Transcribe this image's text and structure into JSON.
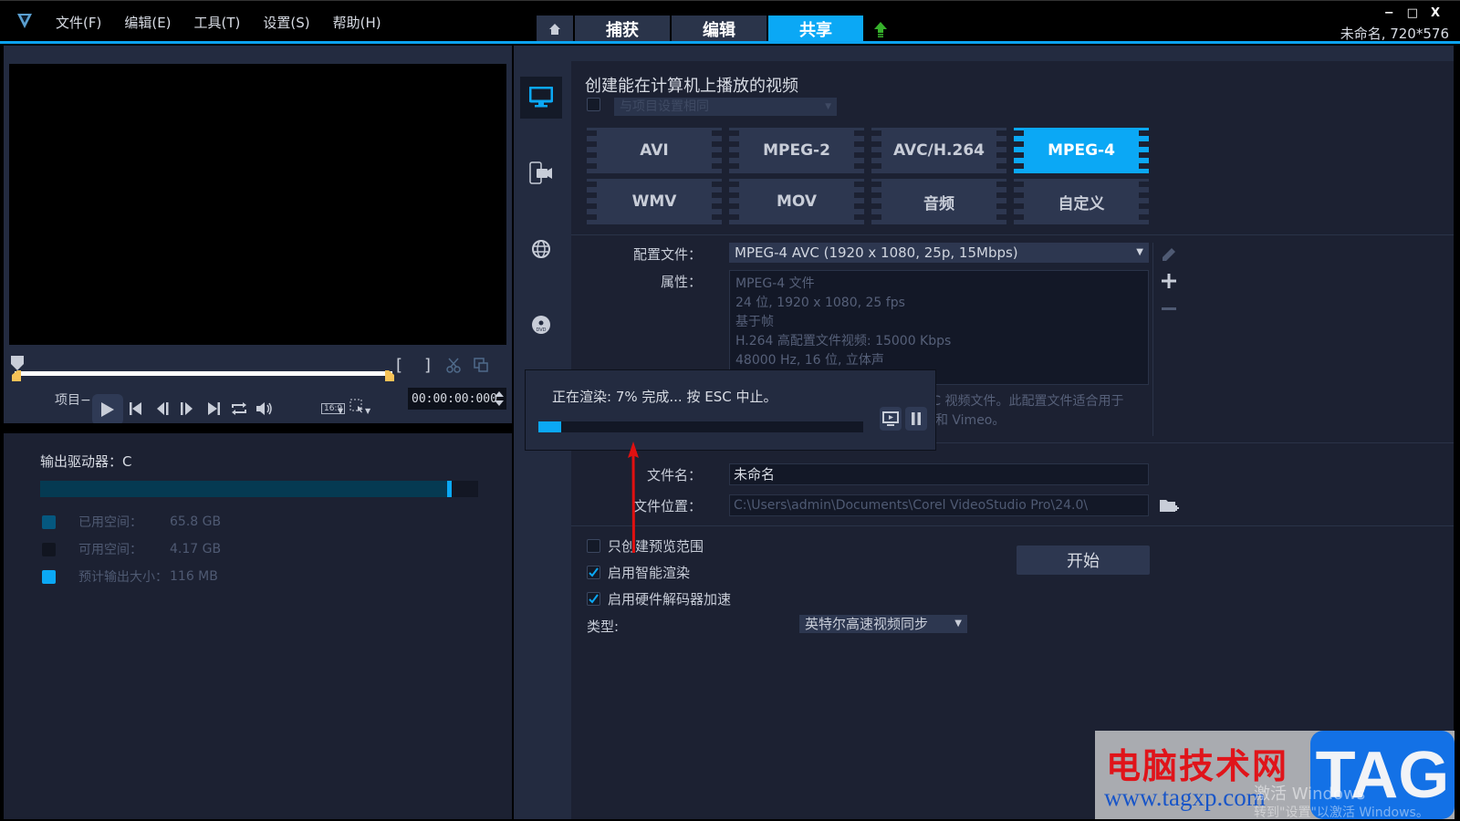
{
  "menu": {
    "items": [
      "文件(F)",
      "编辑(E)",
      "工具(T)",
      "设置(S)",
      "帮助(H)"
    ]
  },
  "tabs": {
    "items": [
      "捕获",
      "编辑",
      "共享"
    ],
    "active": "共享"
  },
  "window": {
    "project_info": "未命名, 720*576",
    "minimize": "−",
    "maximize": "□",
    "close": "X"
  },
  "player": {
    "project_label": "项目−",
    "bracket_in": "[",
    "bracket_out": "]",
    "aspect": "16:9",
    "timecode": "00:00:00:000"
  },
  "drive": {
    "label": "输出驱动器：C",
    "used_fraction": 0.94,
    "legend": [
      {
        "label": "已用空间：",
        "value": "65.8 GB",
        "color": "#05587f"
      },
      {
        "label": "可用空间：",
        "value": "4.17 GB",
        "color": "#111520"
      },
      {
        "label": "预计输出大小：",
        "value": "116 MB",
        "color": "#0ba8f5"
      }
    ]
  },
  "share": {
    "section_title": "创建能在计算机上播放的视频",
    "same_as_project": "与项目设置相同",
    "same_as_project_checked": false,
    "formats": [
      "AVI",
      "MPEG-2",
      "AVC/H.264",
      "MPEG-4",
      "WMV",
      "MOV",
      "音频",
      "自定义"
    ],
    "active_format": "MPEG-4",
    "profile_label": "配置文件：",
    "profile_value": "MPEG-4 AVC (1920 x 1080, 25p, 15Mbps)",
    "properties_label": "属性：",
    "properties": [
      "MPEG-4 文件",
      "24 位, 1920 x 1080, 25 fps",
      "基于帧",
      "H.264 高配置文件视频: 15000 Kbps",
      "48000 Hz, 16 位, 立体声"
    ],
    "description": [
      "AVC 视频文件。此配置文件适合用于",
      "be 和 Vimeo。"
    ],
    "filename_label": "文件名：",
    "filename_value": "未命名",
    "location_label": "文件位置：",
    "location_value": "C:\\Users\\admin\\Documents\\Corel VideoStudio Pro\\24.0\\",
    "options": [
      {
        "label": "只创建预览范围",
        "checked": false
      },
      {
        "label": "启用智能渲染",
        "checked": true
      },
      {
        "label": "启用硬件解码器加速",
        "checked": true
      }
    ],
    "type_label": "类型:",
    "type_value": "英特尔高速视频同步",
    "start_label": "开始"
  },
  "render": {
    "status": "正在渲染: 7% 完成... 按 ESC 中止。",
    "progress_percent": 7
  },
  "watermark": {
    "site_name": "电脑技术网",
    "url": "www.tagxp.com",
    "tag": "TAG",
    "activate_line1": "激活 Windows",
    "activate_line2": "转到\"设置\"以激活 Windows。"
  }
}
